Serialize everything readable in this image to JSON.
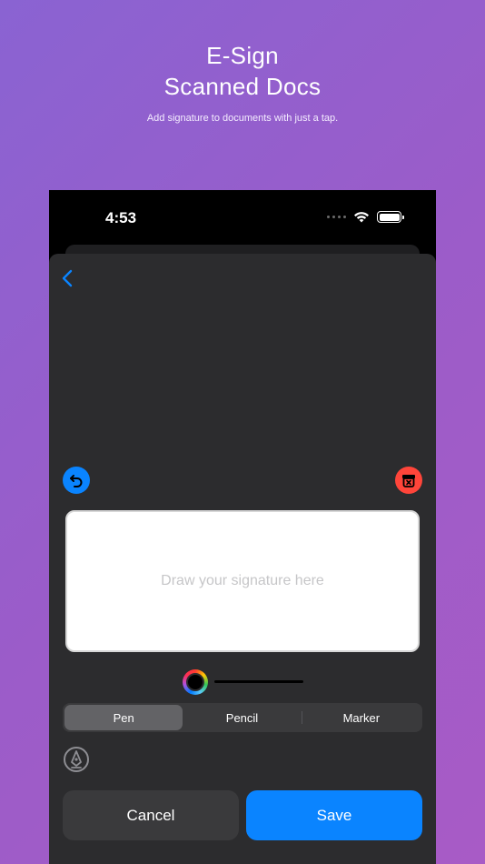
{
  "hero": {
    "title_line1": "E-Sign",
    "title_line2": "Scanned Docs",
    "subtitle": "Add signature to documents with just a tap."
  },
  "status_bar": {
    "time": "4:53"
  },
  "signature": {
    "placeholder": "Draw your signature here"
  },
  "tools": {
    "segments": [
      "Pen",
      "Pencil",
      "Marker"
    ],
    "selected": "Pen"
  },
  "actions": {
    "cancel_label": "Cancel",
    "save_label": "Save"
  },
  "colors": {
    "accent": "#0a84ff",
    "destructive": "#ff453a",
    "sheet": "#2c2c2e",
    "current_ink": "#000000"
  },
  "icons": {
    "back": "chevron-left-icon",
    "undo": "undo-icon",
    "clear": "trash-icon",
    "color": "color-picker-icon",
    "pen_tool": "pen-tip-icon"
  }
}
